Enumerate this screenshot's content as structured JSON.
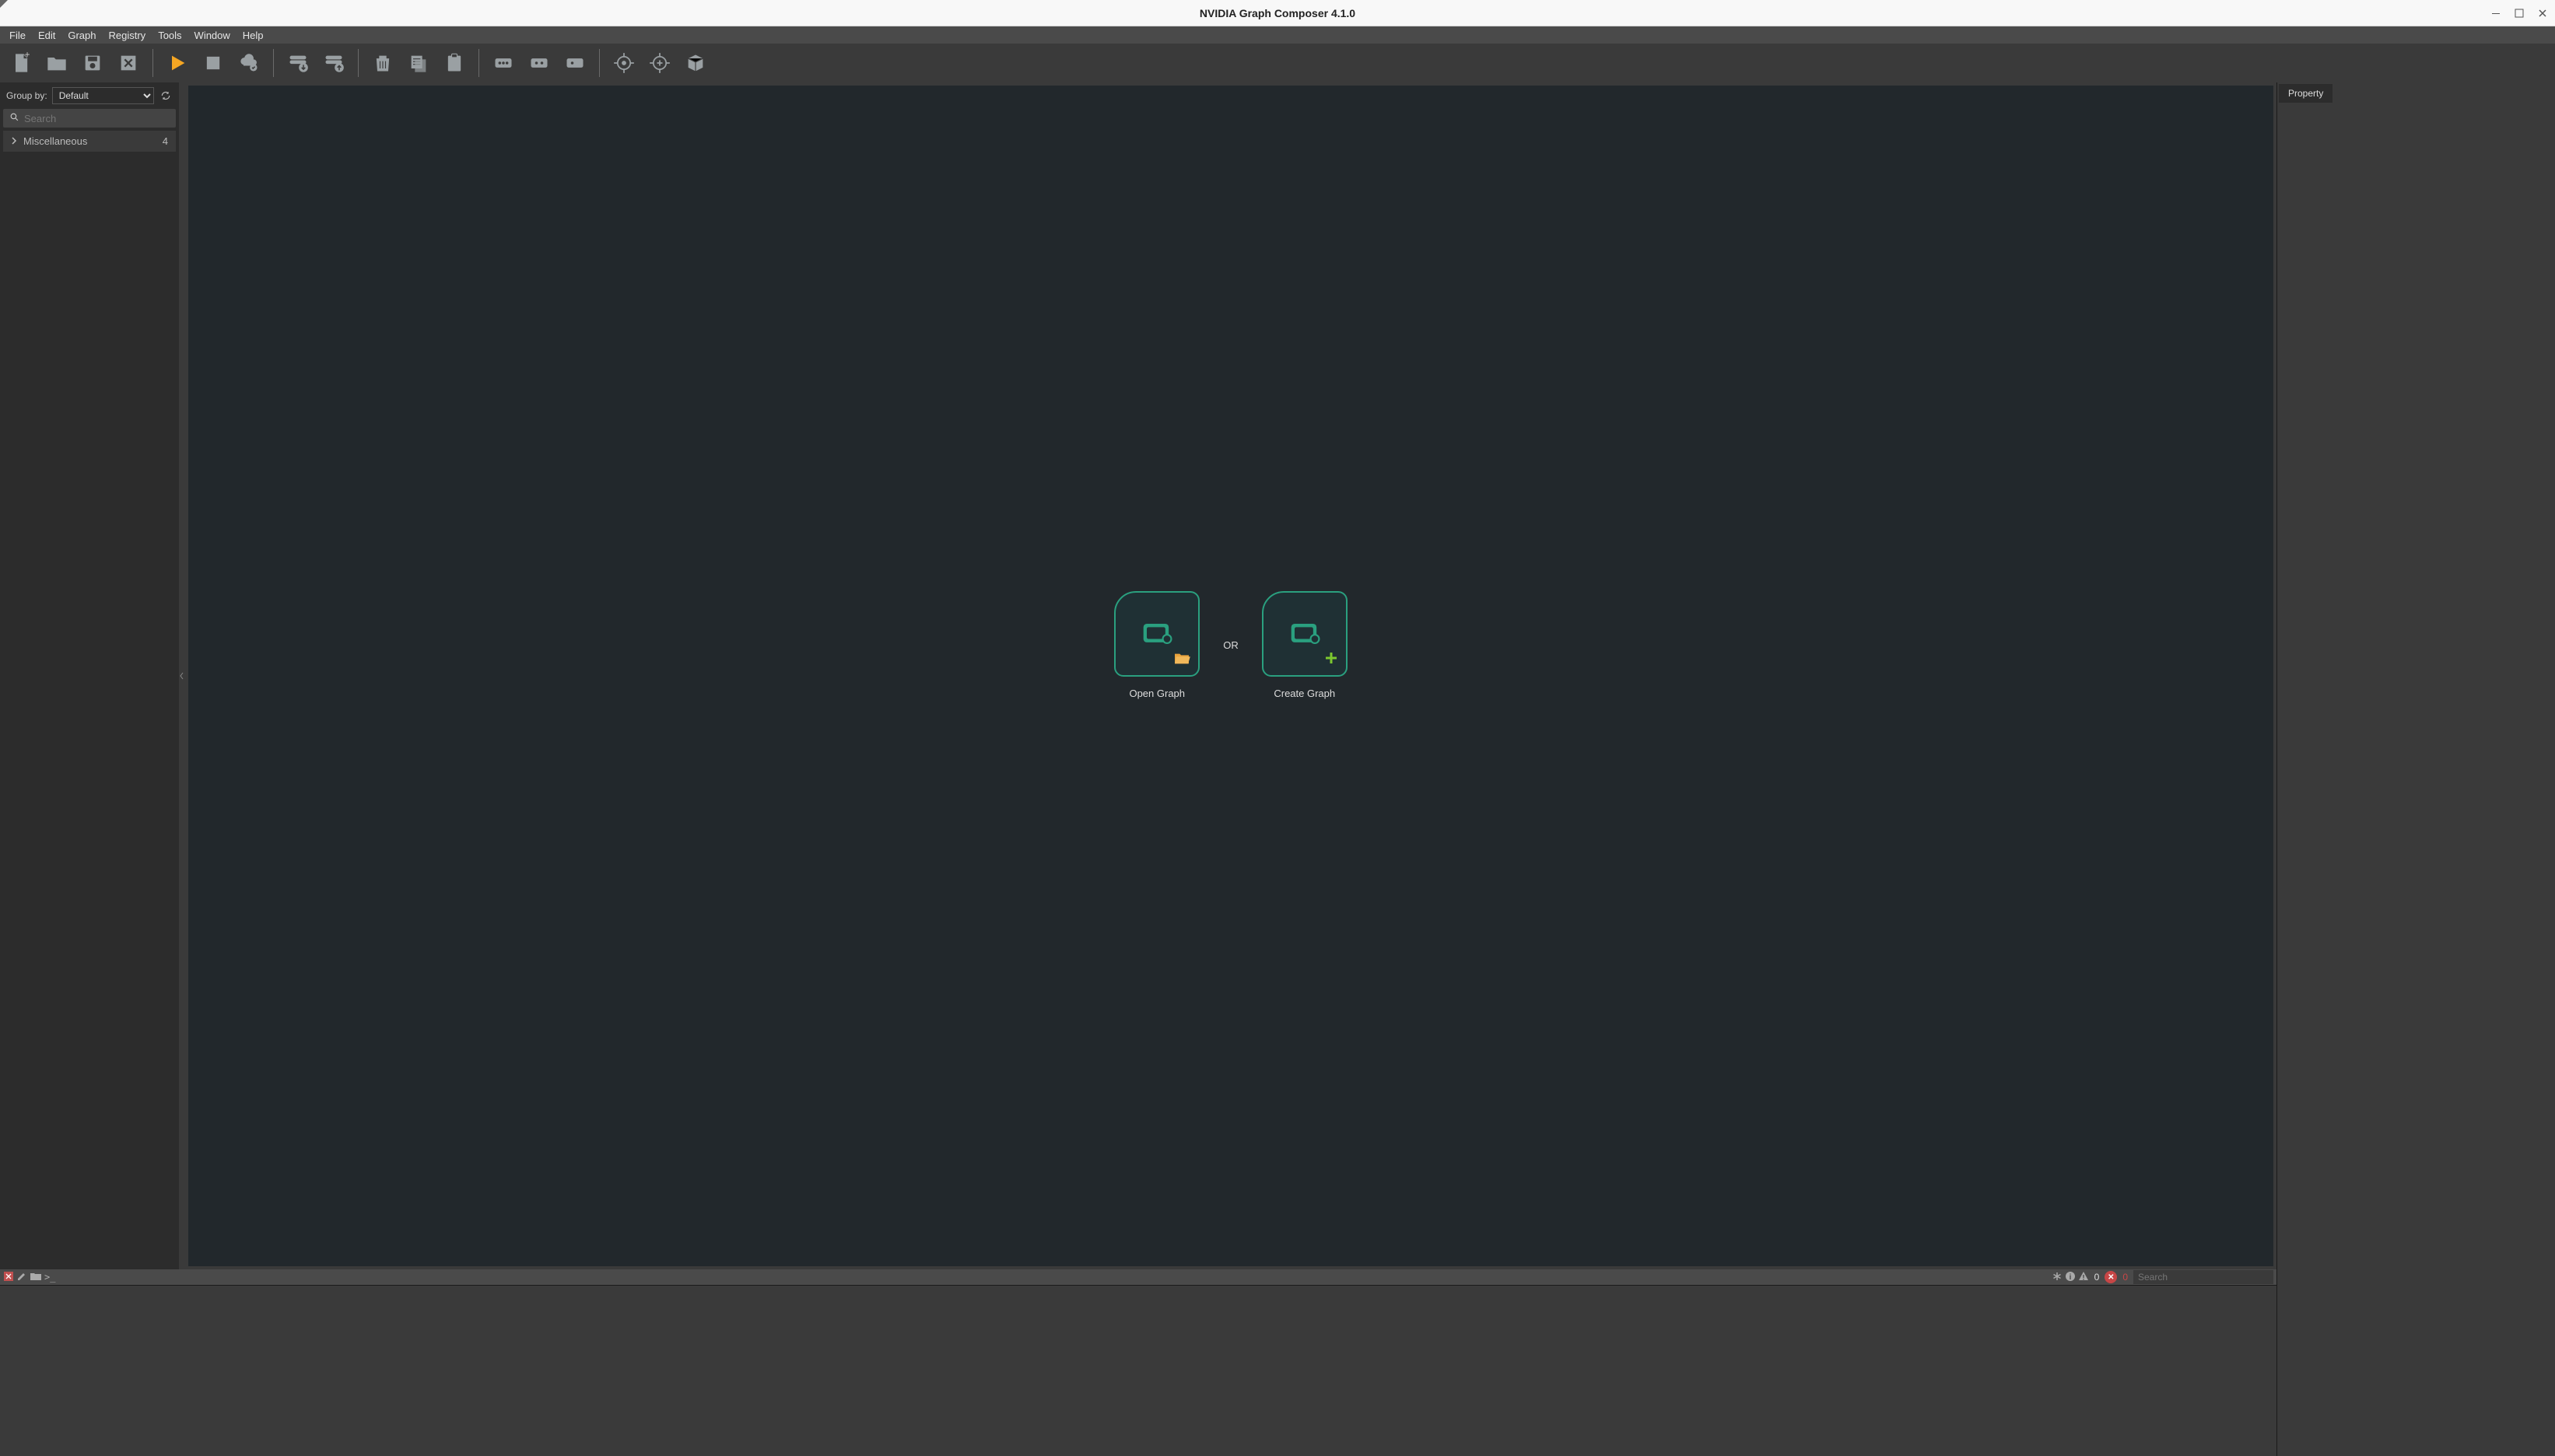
{
  "window": {
    "title": "NVIDIA Graph Composer 4.1.0"
  },
  "menu": {
    "file": "File",
    "edit": "Edit",
    "graph": "Graph",
    "registry": "Registry",
    "tools": "Tools",
    "window": "Window",
    "help": "Help"
  },
  "sidebar": {
    "group_by_label": "Group by:",
    "group_by_value": "Default",
    "search_placeholder": "Search",
    "tree": [
      {
        "label": "Miscellaneous",
        "count": "4"
      }
    ]
  },
  "canvas": {
    "open_label": "Open Graph",
    "create_label": "Create Graph",
    "or_label": "OR"
  },
  "right_panel": {
    "tab_label": "Property"
  },
  "console": {
    "warning_count": "0",
    "error_count": "0",
    "search_placeholder": "Search"
  }
}
